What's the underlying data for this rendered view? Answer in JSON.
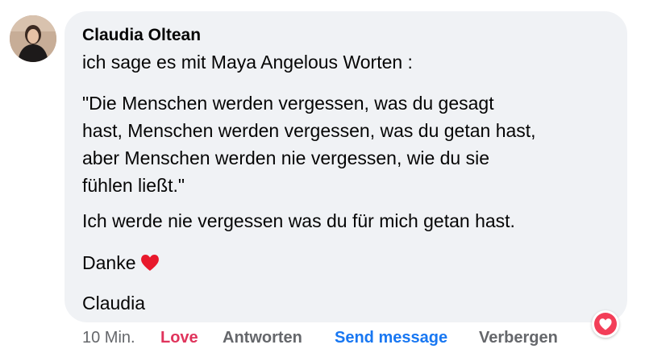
{
  "comment": {
    "author": "Claudia Oltean",
    "paragraphs": {
      "intro": "ich sage es mit Maya Angelous Worten :",
      "quote_lines": [
        "\"Die Menschen werden vergessen, was du gesagt",
        "hast, Menschen werden vergessen, was du getan hast,",
        "aber Menschen werden nie vergessen, wie du sie",
        "fühlen ließt.\""
      ],
      "line3": "Ich werde nie vergessen was du für mich getan hast.",
      "thanks": "Danke",
      "signature": "Claudia"
    },
    "thanks_emoji": "red-heart-emoji"
  },
  "actions": {
    "time": "10 Min.",
    "love": "Love",
    "reply": "Antworten",
    "send_message": "Send message",
    "hide": "Verbergen"
  },
  "reaction": {
    "icon": "love-reaction-icon",
    "color": "#f33e58"
  },
  "colors": {
    "bubble": "#f0f2f5",
    "love_action": "#e0345c",
    "link": "#1877f2",
    "muted": "#65676b"
  }
}
